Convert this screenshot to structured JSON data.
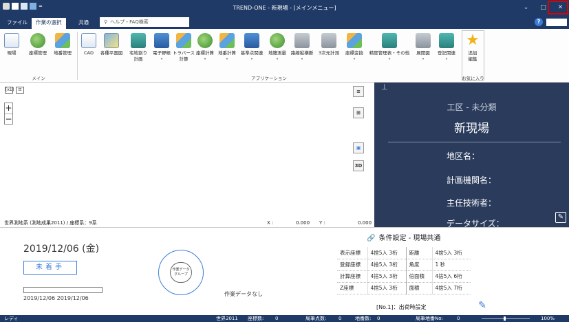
{
  "window": {
    "title": "TREND-ONE - 新現場 - [メインメニュー]",
    "qat_caret": "=",
    "controls": {
      "minimize": "⌄",
      "restore": "□",
      "close": "✕"
    }
  },
  "tabs": [
    {
      "label": "ファイル",
      "active": false
    },
    {
      "label": "作業の選択",
      "active": true
    },
    {
      "label": "共通",
      "active": false
    }
  ],
  "help_search": {
    "placeholder": "ヘルプ・FAQ検索"
  },
  "help_icon": "?",
  "ribbon": {
    "groups": {
      "main": "メイン",
      "application": "アプリケーション",
      "favorites": "お気に入り"
    },
    "main_buttons": [
      {
        "label": "現場",
        "icon": "document-icon"
      },
      {
        "label": "座標管理",
        "icon": "coordinate-icon"
      },
      {
        "label": "地番管理",
        "icon": "lot-icon"
      }
    ],
    "app_buttons": [
      {
        "label": "CAD",
        "sub": "",
        "arrow": ""
      },
      {
        "label": "各種平面図",
        "sub": "",
        "arrow": ""
      },
      {
        "label": "宅地割り",
        "sub": "計画",
        "arrow": ""
      },
      {
        "label": "電子野帳",
        "sub": "",
        "arrow": "▾"
      },
      {
        "label": "トラバース",
        "sub": "計算",
        "arrow": ""
      },
      {
        "label": "座標計算",
        "sub": "",
        "arrow": "▾"
      },
      {
        "label": "地番計算",
        "sub": "",
        "arrow": "▾"
      },
      {
        "label": "基準点関連",
        "sub": "",
        "arrow": "▾"
      },
      {
        "label": "地籍測量",
        "sub": "",
        "arrow": "▾"
      },
      {
        "label": "路線縦横断",
        "sub": "",
        "arrow": "▾"
      },
      {
        "label": "3次元計測",
        "sub": "",
        "arrow": ""
      },
      {
        "label": "座標変換",
        "sub": "",
        "arrow": "▾"
      },
      {
        "label": "精度管理表・その他",
        "sub": "",
        "arrow": "▾"
      },
      {
        "label": "展開図",
        "sub": "",
        "arrow": "▾"
      },
      {
        "label": "登記関連",
        "sub": "",
        "arrow": "▾"
      }
    ],
    "favorites_button": {
      "label": "追加",
      "sub": "編集"
    }
  },
  "canvas": {
    "tool1": "[x1]",
    "tool2": "⊡",
    "zoom_in": "+",
    "zoom_out": "−",
    "list_icon": "≡",
    "grid_icon": "⊞",
    "map_icon": "▣",
    "view3d": "3D"
  },
  "coordbar": {
    "system": "世界測地系 (測地成果2011) / 座標系：9系",
    "x_label": "X :",
    "x_value": "0.000",
    "y_label": "Y :",
    "y_value": "0.000"
  },
  "info_panel": {
    "pin": "⊥",
    "kouku": "工区 - 未分類",
    "project_name": "新現場",
    "labels": [
      "地区名：",
      "計画機関名：",
      "主任技術者：",
      "データサイズ："
    ]
  },
  "summary": {
    "date": "2019/12/06 (金)",
    "status": "未着手",
    "progress": 0,
    "date_range": "2019/12/06  2019/12/06",
    "group_label_line1": "作業データ",
    "group_label_line2": "グループ",
    "no_data": "作業データなし"
  },
  "conditions": {
    "title": "条件設定 - 現場共通",
    "rows": [
      {
        "k": "表示座標",
        "v": "4捨5入 3桁",
        "k2": "距離",
        "v2": "4捨5入 3桁"
      },
      {
        "k": "登録座標",
        "v": "4捨5入 3桁",
        "k2": "角度",
        "v2": "1 秒"
      },
      {
        "k": "計算座標",
        "v": "4捨5入 3桁",
        "k2": "倍面積",
        "v2": "4捨5入 6桁"
      },
      {
        "k": "Z座標",
        "v": "4捨5入 3桁",
        "k2": "面積",
        "v2": "4捨5入 7桁"
      }
    ],
    "shipping": "[No.1]：出荷時設定"
  },
  "footer": {
    "ready": "レディ",
    "geo": "世界2011",
    "coord_count_label": "座標数:",
    "coord_count": "0",
    "lot_point_label": "局筆点数:",
    "lot_point": "0",
    "lot_count_label": "地番数:",
    "lot_count": "0",
    "lot_no_label": "局筆地番No:",
    "lot_no": "0",
    "zoom": "100%"
  }
}
